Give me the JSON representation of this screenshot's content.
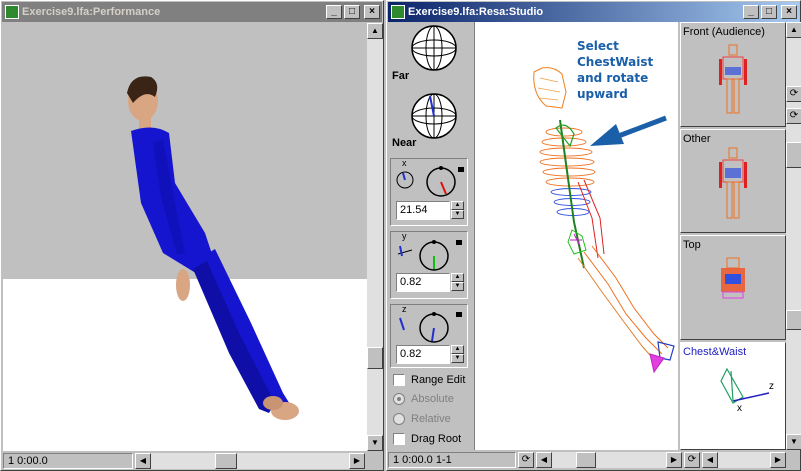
{
  "performance_window": {
    "title": "Exercise9.lfa:Performance",
    "status": "1 0:00.0",
    "title_buttons": [
      "_",
      "□",
      "×"
    ]
  },
  "studio_window": {
    "title": "Exercise9.lfa:Resa:Studio",
    "status": "1 0:00.0 1-1",
    "title_buttons": [
      "_",
      "□",
      "×"
    ],
    "far_label": "Far",
    "near_label": "Near",
    "x_axis": {
      "label": "x",
      "value": "21.54"
    },
    "y_axis": {
      "label": "y",
      "value": "0.82"
    },
    "z_axis": {
      "label": "z",
      "value": "0.82"
    },
    "range_edit_label": "Range Edit",
    "absolute_label": "Absolute",
    "relative_label": "Relative",
    "drag_root_label": "Drag Root",
    "annotation": "Select\nChestWaist\nand rotate\nupward",
    "annotation_color": "#1a5fa8",
    "previews": [
      {
        "label": "Front (Audience)"
      },
      {
        "label": "Other"
      },
      {
        "label": "Top"
      },
      {
        "label": "Chest&Waist"
      }
    ]
  },
  "colors": {
    "title_active": "#0a246a",
    "title_inactive": "#808080",
    "figure_suit": "#1515d0",
    "skin": "#d9a684",
    "floor_wall": "#c0c0c0"
  }
}
